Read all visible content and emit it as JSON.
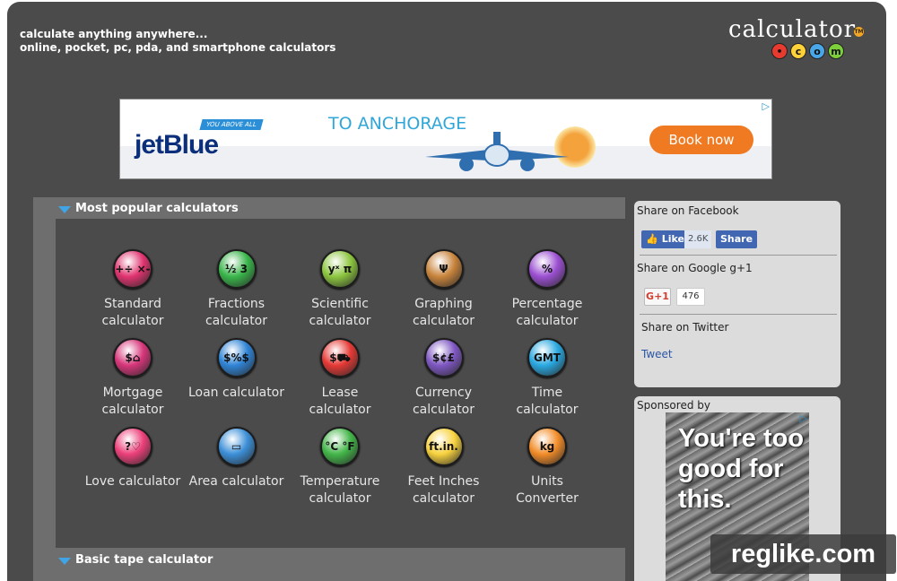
{
  "header": {
    "tagline_line1": "calculate anything anywhere...",
    "tagline_line2": "online, pocket, pc, pda, and smartphone calculators",
    "logo_word": "calculator",
    "logo_tm": "TM",
    "logo_dots": [
      {
        "glyph": "•",
        "color": "#e83a2e"
      },
      {
        "glyph": "c",
        "color": "#ffd23a"
      },
      {
        "glyph": "o",
        "color": "#49a7e8"
      },
      {
        "glyph": "m",
        "color": "#7ccf3a"
      }
    ]
  },
  "top_ad": {
    "brand": "jetBlue",
    "tag": "YOU ABOVE ALL",
    "headline": "TO ANCHORAGE",
    "cta": "Book now",
    "choice_icon": "adchoices-icon"
  },
  "sections": {
    "popular_title": "Most popular calculators",
    "tape_title": "Basic tape calculator"
  },
  "calculators": [
    {
      "line1": "Standard",
      "line2": "calculator",
      "glyph": "+÷\n×-",
      "color": "#e0336f",
      "icon": "standard-calc-icon"
    },
    {
      "line1": "Fractions",
      "line2": "calculator",
      "glyph": "½ 3",
      "color": "#39b54a",
      "icon": "fractions-calc-icon"
    },
    {
      "line1": "Scientific",
      "line2": "calculator",
      "glyph": "yˣ π",
      "color": "#8cc63f",
      "icon": "scientific-calc-icon"
    },
    {
      "line1": "Graphing",
      "line2": "calculator",
      "glyph": "Ψ",
      "color": "#c8843c",
      "icon": "graphing-calc-icon"
    },
    {
      "line1": "Percentage",
      "line2": "calculator",
      "glyph": "%",
      "color": "#9b4fd1",
      "icon": "percentage-calc-icon"
    },
    {
      "line1": "Mortgage",
      "line2": "calculator",
      "glyph": "$⌂",
      "color": "#d6367a",
      "icon": "mortgage-calc-icon"
    },
    {
      "line1": "Loan calculator",
      "line2": "",
      "glyph": "$%$",
      "color": "#2f84d6",
      "icon": "loan-calc-icon"
    },
    {
      "line1": "Lease",
      "line2": "calculator",
      "glyph": "$⛟",
      "color": "#e53935",
      "icon": "lease-calc-icon"
    },
    {
      "line1": "Currency",
      "line2": "calculator",
      "glyph": "$¢£",
      "color": "#7e57c2",
      "icon": "currency-calc-icon"
    },
    {
      "line1": "Time",
      "line2": "calculator",
      "glyph": "GMT",
      "color": "#29a8e0",
      "icon": "time-calc-icon"
    },
    {
      "line1": "Love calculator",
      "line2": "",
      "glyph": "?♡",
      "color": "#ec407a",
      "icon": "love-calc-icon"
    },
    {
      "line1": "Area calculator",
      "line2": "",
      "glyph": "▭",
      "color": "#3c8fd8",
      "icon": "area-calc-icon"
    },
    {
      "line1": "Temperature",
      "line2": "calculator",
      "glyph": "°C °F",
      "color": "#43b649",
      "icon": "temperature-calc-icon"
    },
    {
      "line1": "Feet Inches",
      "line2": "calculator",
      "glyph": "ft.in.",
      "color": "#f7d23e",
      "icon": "feet-inches-calc-icon"
    },
    {
      "line1": "Units",
      "line2": "Converter",
      "glyph": "kg",
      "color": "#f28c28",
      "icon": "units-converter-icon"
    }
  ],
  "share": {
    "facebook_title": "Share on Facebook",
    "like_label": "Like",
    "like_count": "2.6K",
    "share_label": "Share",
    "google_title": "Share on Google g+1",
    "gplus_label": "G+1",
    "gplus_count": "476",
    "twitter_title": "Share on Twitter",
    "tweet_label": "Tweet"
  },
  "sponsored": {
    "title": "Sponsored by",
    "ad_text": "You're too good for this."
  },
  "watermark": "reglike.com"
}
